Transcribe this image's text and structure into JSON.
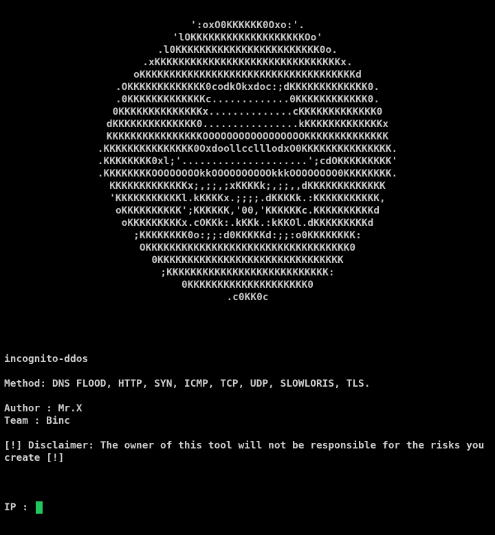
{
  "banner": {
    "lines": [
      "':oxO0KKKKKK0Oxo:'.",
      "'lOKKKKKKKKKKKKKKKKKKKOo'",
      ".l0KKKKKKKKKKKKKKKKKKKKKKKK0o.",
      ".xKKKKKKKKKKKKKKKKKKKKKKKKKKKKKKKx.",
      "oKKKKKKKKKKKKKKKKKKKKKKKKKKKKKKKKKKKKd",
      ".OKKKKKKKKKKKKK0codkOkxdoc:;dKKKKKKKKKKKKK0.",
      ".0KKKKKKKKKKKKKc.............0KKKKKKKKKKKK0.",
      "0KKKKKKKKKKKKKKx..............cKKKKKKKKKKKKK0",
      "dKKKKKKKKKKKKKK0................kKKKKKKKKKKKKKx",
      "KKKKKKKKKKKKKKKKOOOOOOOOOOOOOOOOOKKKKKKKKKKKKKK",
      ".KKKKKKKKKKKKKKK0OxdoollcclllodxO0KKKKKKKKKKKKKKK.",
      ".KKKKKKKK0xl;'.....................';cdOKKKKKKKKK'",
      ".KKKKKKKKOOOOOOOOkkOOOOOOOOOOkkkOOOOOOOO0KKKKKKKK.",
      "KKKKKKKKKKKKKx;,;;,;xKKKKk;,;;,,dKKKKKKKKKKKKK",
      "'KKKKKKKKKKKl.kKKKKx.;;;;.dKKKKk.:KKKKKKKKKKK,",
      "oKKKKKKKKKK';KKKKKK,'00,'KKKKKKc.KKKKKKKKKKd",
      "oKKKKKKKKKx.cOKKk:.kKKk.:kKKOl.dKKKKKKKKKd",
      ";KKKKKKKK0o:;;:d0KKKKKd:;;:o0KKKKKKKK:",
      "OKKKKKKKKKKKKKKKKKKKKKKKKKKKKKKKKKK0",
      "0KKKKKKKKKKKKKKKKKKKKKKKKKKKKKKK",
      ";KKKKKKKKKKKKKKKKKKKKKKKKKKK:",
      "0KKKKKKKKKKKKKKKKKKKK0",
      ".c0KK0c"
    ]
  },
  "tool_name": "incognito-ddos",
  "methods_line": "Method: DNS FLOOD, HTTP, SYN, ICMP, TCP, UDP, SLOWLORIS, TLS.",
  "author_line": "Author : Mr.X",
  "team_line": "Team : Binc",
  "disclaimer": "[!] Disclaimer: The owner of this tool will not be responsible for the risks you create [!]",
  "prompt": {
    "label": "IP : ",
    "value": ""
  },
  "colors": {
    "background": "#000000",
    "text": "#cfcfcf",
    "cursor": "#22c55e"
  }
}
